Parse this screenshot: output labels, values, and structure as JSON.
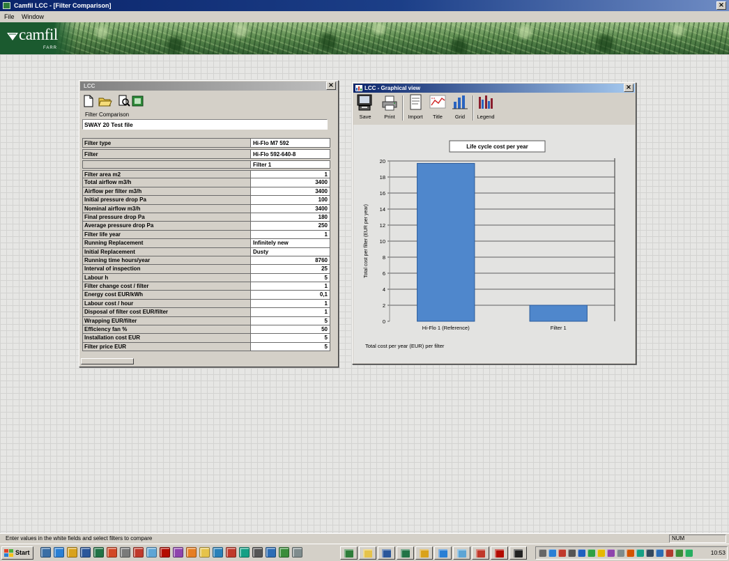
{
  "app": {
    "title": "Camfil LCC - [Filter Comparison]",
    "close": "×"
  },
  "menu": [
    {
      "label": "File"
    },
    {
      "label": "Window"
    }
  ],
  "banner": {
    "logo_text": "camfil",
    "logo_sub": "FARR"
  },
  "left_window": {
    "title": "LCC",
    "close": "×",
    "toolbar": [
      {
        "icon": "new-document-icon"
      },
      {
        "icon": "open-folder-icon"
      },
      {
        "icon": "print-preview-icon"
      },
      {
        "icon": "export-excel-icon"
      }
    ],
    "name_label": "Filter Comparison",
    "name_value": "SWAY 20 Test file",
    "header_rows": [
      {
        "label": "Filter type",
        "value": "Hi-Flo M7 592"
      },
      {
        "label": "Filter",
        "value": "Hi-Flo 592-640-8"
      },
      {
        "label": "",
        "value": "Filter 1"
      }
    ],
    "rows": [
      {
        "label": "Filter area m2",
        "value": "1"
      },
      {
        "label": "Total airflow m3/h",
        "value": "3400"
      },
      {
        "label": "Airflow per filter m3/h",
        "value": "3400"
      },
      {
        "label": "Initial pressure drop Pa",
        "value": "100"
      },
      {
        "label": "Nominal airflow m3/h",
        "value": "3400"
      },
      {
        "label": "Final pressure drop Pa",
        "value": "180"
      },
      {
        "label": "Average pressure drop Pa",
        "value": "250"
      },
      {
        "label": "Filter life year",
        "value": "1"
      },
      {
        "label": "Running Replacement",
        "value": "Infinitely new"
      },
      {
        "label": "Initial Replacement",
        "value": "Dusty"
      },
      {
        "label": "Running time hours/year",
        "value": "8760"
      },
      {
        "label": "Interval of inspection",
        "value": "25"
      },
      {
        "label": "Labour h",
        "value": "5"
      },
      {
        "label": "Filter change cost / filter",
        "value": "1"
      },
      {
        "label": "Energy cost EUR/kWh",
        "value": "0,1"
      },
      {
        "label": "Labour cost / hour",
        "value": "1"
      },
      {
        "label": "Disposal of filter cost EUR/filter",
        "value": "1"
      },
      {
        "label": "Wrapping EUR/filter",
        "value": "5"
      },
      {
        "label": "Efficiency fan %",
        "value": "50"
      },
      {
        "label": "Installation cost EUR",
        "value": "5"
      },
      {
        "label": "Filter price EUR",
        "value": "5"
      }
    ]
  },
  "right_window": {
    "title": "LCC - Graphical view",
    "close": "×",
    "toolbar": [
      {
        "icon": "save-icon",
        "label": "Save"
      },
      {
        "icon": "print-icon",
        "label": "Print"
      },
      {
        "icon": "import-icon",
        "label": "Import"
      },
      {
        "icon": "title-icon",
        "label": "Title"
      },
      {
        "icon": "grid-icon",
        "label": "Grid"
      },
      {
        "icon": "legend-icon",
        "label": "Legend"
      }
    ]
  },
  "chart_data": {
    "type": "bar",
    "title": "Life cycle cost per year",
    "categories": [
      "Hi-Flo 1 (Reference)",
      "Filter 1"
    ],
    "values": [
      19.7,
      2.0
    ],
    "xlabel": "",
    "ylabel": "Total cost per filter (EUR per year)",
    "ylim": [
      0,
      20
    ],
    "yticks": [
      0,
      2,
      4,
      6,
      8,
      10,
      12,
      14,
      16,
      18,
      20
    ],
    "grid": true,
    "legend": false,
    "footnote": "Total cost per year (EUR) per filter",
    "bar_color": "#4f87cc"
  },
  "status_bar": {
    "text": "Enter values in the white fields and select filters to compare",
    "panel": "NUM"
  },
  "taskbar": {
    "start_label": "Start",
    "clock": "10:53",
    "quick_launch": [
      {
        "icon": "show-desktop-icon",
        "color": "#3a6ea5"
      },
      {
        "icon": "internet-explorer-icon",
        "color": "#2a7fd4"
      },
      {
        "icon": "outlook-icon",
        "color": "#d9a21b"
      },
      {
        "icon": "word-icon",
        "color": "#2b579a"
      },
      {
        "icon": "excel-icon",
        "color": "#217346"
      },
      {
        "icon": "powerpoint-icon",
        "color": "#d24726"
      },
      {
        "icon": "calculator-icon",
        "color": "#7a7a7a"
      },
      {
        "icon": "paint-icon",
        "color": "#c0392b"
      },
      {
        "icon": "notepad-icon",
        "color": "#5da5d5"
      },
      {
        "icon": "acrobat-icon",
        "color": "#b30b00"
      },
      {
        "icon": "winzip-icon",
        "color": "#8e44ad"
      },
      {
        "icon": "media-player-icon",
        "color": "#e67e22"
      },
      {
        "icon": "folder-icon",
        "color": "#e6c34a"
      },
      {
        "icon": "calendar-icon",
        "color": "#2980b9"
      },
      {
        "icon": "mail-icon",
        "color": "#c0392b"
      },
      {
        "icon": "network-icon",
        "color": "#16a085"
      },
      {
        "icon": "printer-icon",
        "color": "#555555"
      },
      {
        "icon": "help-icon",
        "color": "#2c6db5"
      },
      {
        "icon": "search-icon",
        "color": "#3a8d3a"
      },
      {
        "icon": "control-panel-icon",
        "color": "#7f8c8d"
      }
    ],
    "tasks": [
      {
        "icon": "camfil-app-icon",
        "color": "#2e7d3a"
      },
      {
        "icon": "explorer-window-icon",
        "color": "#e6c34a"
      },
      {
        "icon": "word-document-icon",
        "color": "#2b579a"
      },
      {
        "icon": "excel-workbook-icon",
        "color": "#217346"
      },
      {
        "icon": "outlook-window-icon",
        "color": "#d9a21b"
      },
      {
        "icon": "browser-window-icon",
        "color": "#2a7fd4"
      },
      {
        "icon": "notepad-window-icon",
        "color": "#5da5d5"
      },
      {
        "icon": "paint-window-icon",
        "color": "#c0392b"
      },
      {
        "icon": "acrobat-window-icon",
        "color": "#b30b00"
      },
      {
        "icon": "command-prompt-icon",
        "color": "#222222"
      }
    ],
    "tray": [
      {
        "icon": "volume-icon",
        "color": "#666666"
      },
      {
        "icon": "network-connection-icon",
        "color": "#2a7fd4"
      },
      {
        "icon": "antivirus-icon",
        "color": "#c0392b"
      },
      {
        "icon": "printer-tray-icon",
        "color": "#555555"
      },
      {
        "icon": "bluetooth-icon",
        "color": "#1f5fbf"
      },
      {
        "icon": "messenger-icon",
        "color": "#2ea043"
      },
      {
        "icon": "update-icon",
        "color": "#e6b800"
      },
      {
        "icon": "display-icon",
        "color": "#8e44ad"
      },
      {
        "icon": "usb-icon",
        "color": "#7f8c8d"
      },
      {
        "icon": "power-icon",
        "color": "#d35400"
      },
      {
        "icon": "sync-icon",
        "color": "#16a085"
      },
      {
        "icon": "keyboard-icon",
        "color": "#34495e"
      },
      {
        "icon": "language-icon",
        "color": "#2c6db5"
      },
      {
        "icon": "security-icon",
        "color": "#b03a2e"
      },
      {
        "icon": "wifi-icon",
        "color": "#3a8d3a"
      },
      {
        "icon": "battery-icon",
        "color": "#27ae60"
      }
    ]
  }
}
